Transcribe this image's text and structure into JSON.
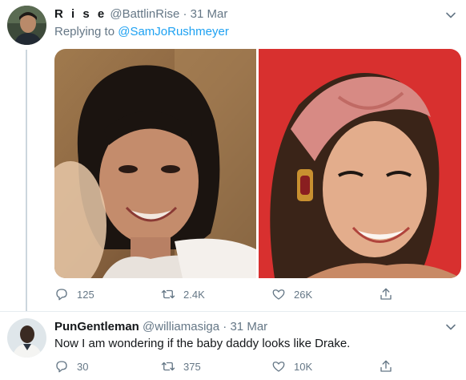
{
  "tweets": [
    {
      "name": "R i s e",
      "handle": "@BattlinRise",
      "separator": "·",
      "date": "31 Mar",
      "replying_prefix": "Replying to",
      "replying_to": "@SamJoRushmeyer",
      "counts": {
        "reply": "125",
        "retweet": "2.4K",
        "like": "26K"
      }
    },
    {
      "name": "PunGentleman",
      "handle": "@williamasiga",
      "separator": "·",
      "date": "31 Mar",
      "text": "Now I am wondering if the baby daddy looks like Drake.",
      "counts": {
        "reply": "30",
        "retweet": "375",
        "like": "10K"
      }
    }
  ],
  "colors": {
    "accent": "#1da1f2",
    "secondary_text": "#657786",
    "divider": "#e6ecf0",
    "thread_line": "#ccd6dd"
  },
  "icons": [
    "reply-icon",
    "retweet-icon",
    "like-icon",
    "share-icon",
    "chevron-down-icon"
  ]
}
